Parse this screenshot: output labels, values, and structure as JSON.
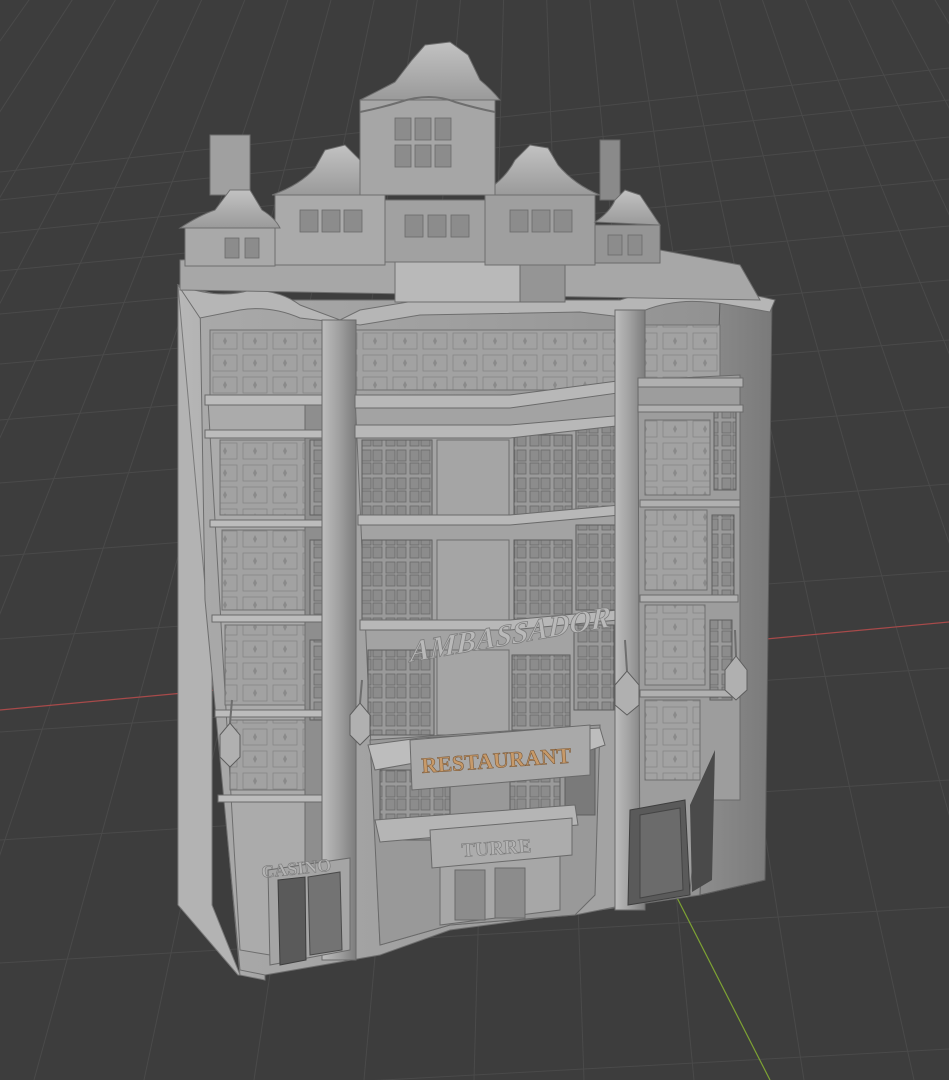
{
  "viewport": {
    "background": "#3d3d3d",
    "grid_color": "#4a4a4a",
    "x_axis_color": "#a84a4a",
    "y_axis_color": "#7da233"
  },
  "model": {
    "base_color": "#9e9e9e",
    "light_color": "#b4b4b4",
    "shadow_color": "#6f6f6f",
    "dark_color": "#4f4f4f",
    "signs": {
      "ambassador": "AMBASSADOR",
      "restaurant": "RESTAURANT",
      "casino": "CASINO",
      "turre": "TURRE"
    },
    "restaurant_sign_color": "#c79a6a"
  }
}
